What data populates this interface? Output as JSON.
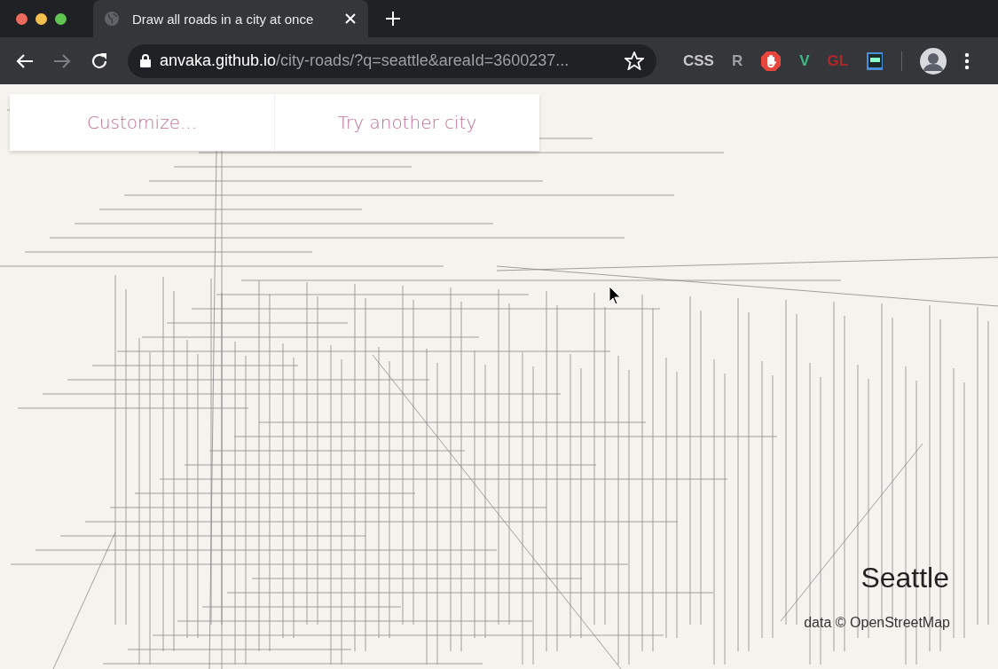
{
  "tabs": [
    {
      "title": "Draw all roads in a city at once",
      "selected": true
    }
  ],
  "address_bar": {
    "host": "anvaka.github.io",
    "path": "/city-roads/?q=seattle&areaId=3600237..."
  },
  "extensions": [
    {
      "kind": "text",
      "label": "CSS",
      "color": "#c8c8c8"
    },
    {
      "kind": "text",
      "label": "R",
      "color": "#9aa0a6"
    },
    {
      "kind": "hand",
      "color": "#e8453c"
    },
    {
      "kind": "text",
      "label": "V",
      "color": "#41b883"
    },
    {
      "kind": "text",
      "label": "GL",
      "color": "#b0282a"
    },
    {
      "kind": "window",
      "color": "#4a90d9"
    }
  ],
  "toolbar_panel": {
    "buttons": [
      "Customize...",
      "Try another city"
    ]
  },
  "map": {
    "city": "Seattle",
    "attribution": "data © OpenStreetMap"
  }
}
